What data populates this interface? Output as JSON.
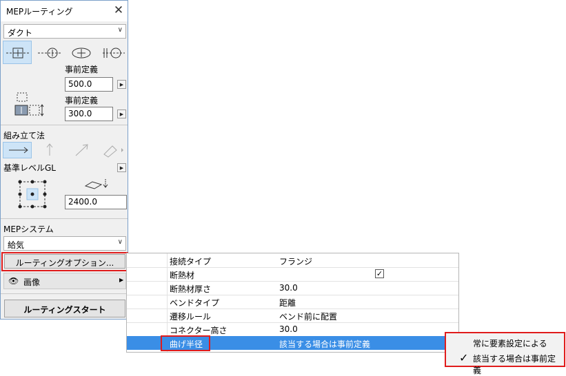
{
  "palette": {
    "title": "MEPルーティング",
    "close_glyph": "✕",
    "type_combo": {
      "value": "ダクト"
    },
    "size": {
      "width_label": "事前定義",
      "width_value": "500.0",
      "height_label": "事前定義",
      "height_value": "300.0"
    },
    "assembly": {
      "label": "組み立て法"
    },
    "reference": {
      "label": "基準レベルGL",
      "elevation_value": "2400.0"
    },
    "system": {
      "label": "MEPシステム",
      "value": "給気"
    },
    "routing_options_button": "ルーティングオプション...",
    "image_section": "画像",
    "start_button": "ルーティングスタート"
  },
  "options_table": {
    "rows": [
      {
        "key": "接続タイプ",
        "value": "フランジ"
      },
      {
        "key": "断熱材",
        "value": "",
        "checkbox": true
      },
      {
        "key": "断熱材厚さ",
        "value": "30.0"
      },
      {
        "key": "ベンドタイプ",
        "value": "距離"
      },
      {
        "key": "遷移ルール",
        "value": "ベンド前に配置"
      },
      {
        "key": "コネクター高さ",
        "value": "30.0"
      },
      {
        "key": "曲げ半径",
        "value": "該当する場合は事前定義",
        "selected": true
      }
    ]
  },
  "popup": {
    "items": [
      {
        "label": "常に要素設定による",
        "checked": false
      },
      {
        "label": "該当する場合は事前定義",
        "checked": true
      }
    ]
  },
  "colors": {
    "selection": "#3a8ee6",
    "highlight_red": "#e01b1b",
    "panel_bg": "#f0f0f0"
  }
}
